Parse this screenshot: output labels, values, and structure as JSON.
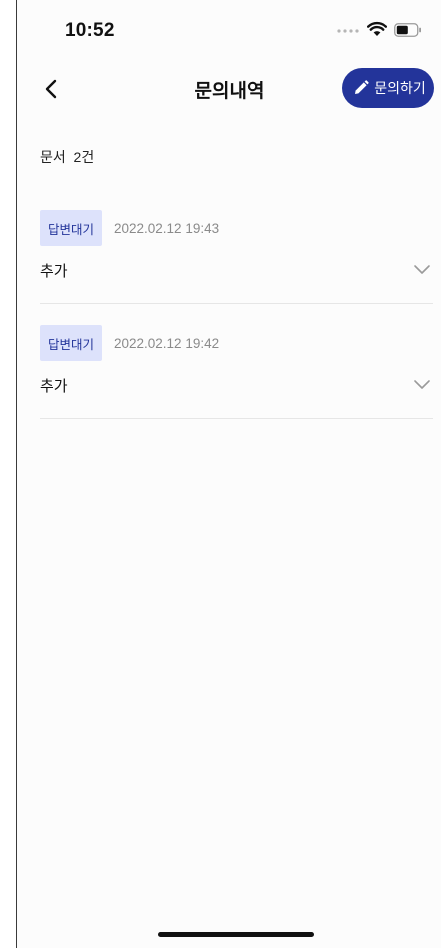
{
  "status_bar": {
    "time": "10:52",
    "signal_icon": "signal-dots-icon",
    "wifi_icon": "wifi-icon",
    "battery_icon": "battery-icon"
  },
  "header": {
    "back_icon": "chevron-left-icon",
    "title": "문의내역",
    "inquire_button": {
      "icon": "pencil-icon",
      "label": "문의하기"
    }
  },
  "summary": {
    "count_text": "문서  2건"
  },
  "inquiries": [
    {
      "status": "답변대기",
      "date": "2022.02.12 19:43",
      "title": "추가",
      "expand_icon": "chevron-down-icon"
    },
    {
      "status": "답변대기",
      "date": "2022.02.12 19:42",
      "title": "추가",
      "expand_icon": "chevron-down-icon"
    }
  ],
  "colors": {
    "accent": "#23349a",
    "badge_bg": "#dde2fb",
    "divider": "#e6e6e6",
    "muted_text": "#8a8a8a"
  }
}
